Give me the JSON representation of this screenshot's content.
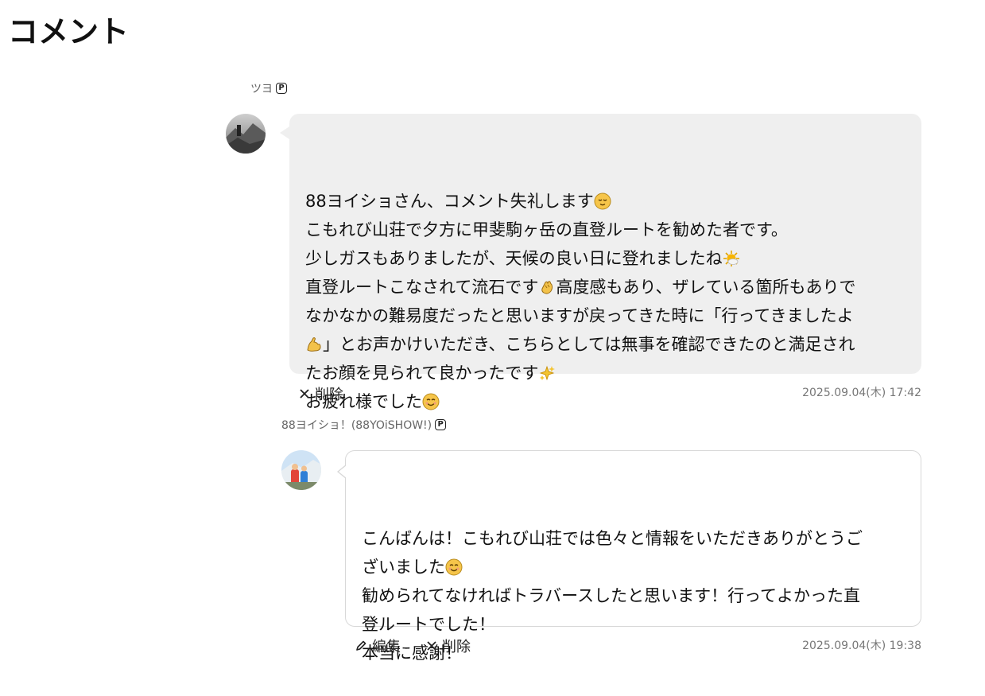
{
  "page": {
    "title": "コメント"
  },
  "comments": [
    {
      "user_name": "ツヨ",
      "premium_badge": "P",
      "lines": [
        "88ヨイショさん、コメント失礼します",
        "こもれび山荘で夕方に甲斐駒ヶ岳の直登ルートを勧めた者です。",
        "少しガスもありましたが、天候の良い日に登れましたね",
        "直登ルートこなされて流石です",
        "高度感もあり、ザレている箇所もありで",
        "なかなかの難易度だったと思いますが戻ってきた時に「行ってきましたよ",
        "」とお声かけいただき、こちらとしては無事を確認できたのと満足され",
        "たお顔を見られて良かったです",
        "お疲れ様でした"
      ],
      "emojis": [
        "relieved-face",
        "sun-behind-cloud",
        "clapping-hands",
        "flexed-biceps",
        "sparkles",
        "smiling-face"
      ],
      "actions": {
        "delete_label": "削除"
      },
      "timestamp": "2025.09.04(木) 17:42"
    },
    {
      "user_name": "88ヨイショ！(88YOiSHOW!)",
      "premium_badge": "P",
      "lines": [
        "こんばんは！こもれび山荘では色々と情報をいただきありがとうご",
        "ざいました",
        "勧められてなければトラバースしたと思います！行ってよかった直",
        "登ルートでした！",
        "本当に感謝！"
      ],
      "emojis": [
        "smiling-face"
      ],
      "actions": {
        "edit_label": "編集",
        "delete_label": "削除"
      },
      "timestamp": "2025.09.04(木) 19:38"
    }
  ],
  "colors": {
    "bubble_gray": "#efefef",
    "bubble_border": "#d8d8d8",
    "meta_text": "#777777"
  }
}
